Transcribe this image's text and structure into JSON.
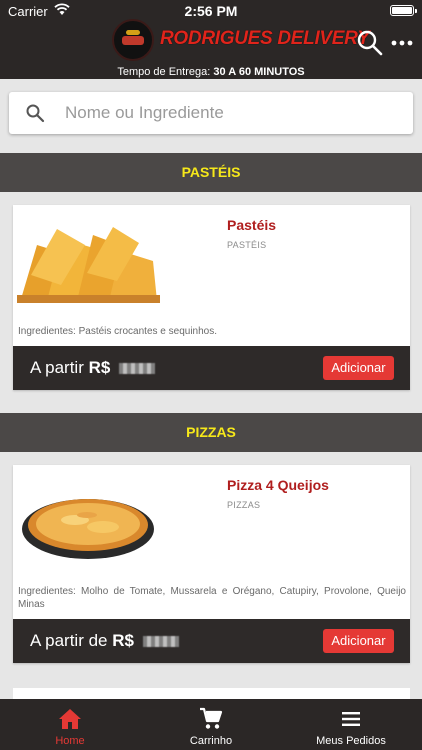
{
  "status_bar": {
    "carrier": "Carrier",
    "time": "2:56 PM"
  },
  "header": {
    "brand": "RODRIGUES DELIVERY",
    "delivery_label": "Tempo de Entrega:",
    "delivery_time": "30 A 60 MINUTOS"
  },
  "search": {
    "placeholder": "Nome ou Ingrediente"
  },
  "categories": [
    {
      "title": "PASTÉIS",
      "item": {
        "name": "Pastéis",
        "category": "PASTÉIS",
        "ingredients": "Ingredientes: Pastéis crocantes e sequinhos.",
        "price_prefix": "A partir",
        "currency": "R$",
        "add_label": "Adicionar"
      }
    },
    {
      "title": "PIZZAS",
      "item": {
        "name": "Pizza 4 Queijos",
        "category": "PIZZAS",
        "ingredients": "Ingredientes: Molho de Tomate, Mussarela e Orégano, Catupiry, Provolone, Queijo Minas",
        "price_prefix": "A partir de",
        "currency": "R$",
        "add_label": "Adicionar"
      }
    }
  ],
  "tabbar": {
    "tabs": [
      {
        "label": "Home",
        "icon": "home-icon",
        "active": true
      },
      {
        "label": "Carrinho",
        "icon": "cart-icon",
        "active": false
      },
      {
        "label": "Meus Pedidos",
        "icon": "list-icon",
        "active": false
      }
    ]
  },
  "colors": {
    "accent": "#e53935",
    "category_text": "#f6e81a",
    "header_bg": "#2b2726",
    "item_name": "#b01e1e"
  }
}
